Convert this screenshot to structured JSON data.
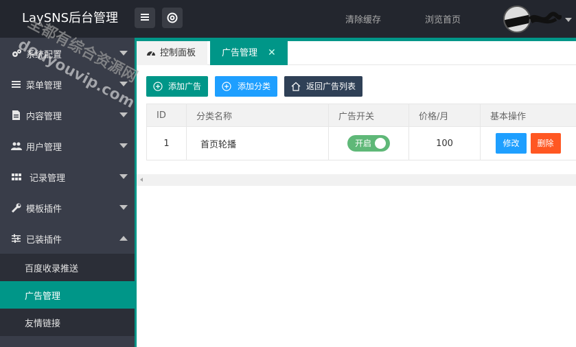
{
  "header": {
    "title": "LaySNS后台管理",
    "links": [
      "清除缓存",
      "浏览首页"
    ]
  },
  "sidebar": {
    "items": [
      {
        "label": "系统配置",
        "icon": "gears-icon"
      },
      {
        "label": "菜单管理",
        "icon": "bars-icon"
      },
      {
        "label": "内容管理",
        "icon": "file-icon"
      },
      {
        "label": "用户管理",
        "icon": "users-icon"
      },
      {
        "label": "记录管理",
        "icon": "grid-icon"
      },
      {
        "label": "模板插件",
        "icon": "wrench-icon"
      },
      {
        "label": "已装插件",
        "icon": "sliders-icon"
      }
    ],
    "subitems": [
      "百度收录推送",
      "广告管理",
      "友情链接"
    ],
    "active_sub": "广告管理"
  },
  "tabs": [
    {
      "label": "控制面板",
      "icon": "dashboard-icon"
    },
    {
      "label": "广告管理",
      "close": "✕"
    }
  ],
  "toolbar": {
    "add_ad": "添加广告",
    "add_category": "添加分类",
    "back_list": "返回广告列表"
  },
  "table": {
    "headers": [
      "ID",
      "分类名称",
      "广告开关",
      "价格/月",
      "基本操作"
    ],
    "rows": [
      {
        "id": "1",
        "name": "首页轮播",
        "switch": "开启",
        "price": "100",
        "edit": "修改",
        "delete": "删除"
      }
    ]
  },
  "watermark": {
    "line1": "全都有综合资源网",
    "line2": "douyouvip.com"
  },
  "colors": {
    "header_bg": "#23262e",
    "sidebar_bg": "#393d49",
    "accent": "#009688",
    "blue": "#1e9fff",
    "navy": "#2f4056",
    "danger": "#ff5722",
    "switch_on": "#5fb878"
  }
}
